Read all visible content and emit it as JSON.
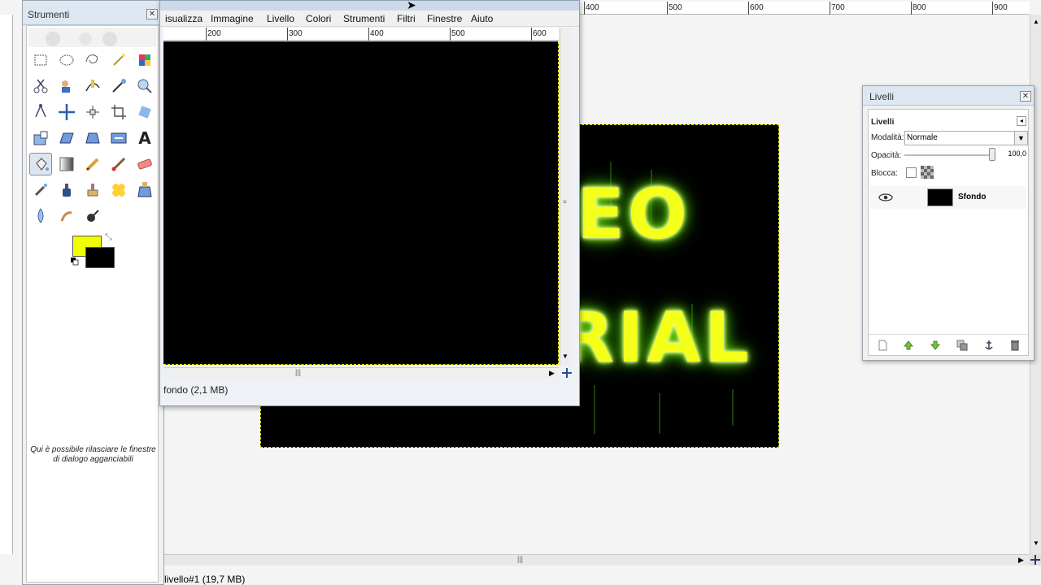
{
  "back_window": {
    "ruler_ticks": [
      "400",
      "500",
      "600",
      "700",
      "800",
      "900"
    ],
    "status_text": "livello#1 (19,7 MB)",
    "canvas_text_line1": "EO",
    "canvas_text_line2": "RIAL"
  },
  "front_window": {
    "menu": [
      "isualizza",
      "Immagine",
      "Livello",
      "Colori",
      "Strumenti",
      "Filtri",
      "Finestre",
      "Aiuto"
    ],
    "ruler_ticks": [
      "200",
      "300",
      "400",
      "500",
      "600"
    ],
    "status_text": "fondo (2,1 MB)"
  },
  "toolbox": {
    "title": "Strumenti",
    "dock_hint": "Qui è possibile rilasciare le finestre di dialogo agganciabili",
    "foreground_color": "#f0ff00",
    "background_color": "#000000",
    "tools": [
      "rect-select-icon",
      "ellipse-select-icon",
      "free-select-icon",
      "fuzzy-select-icon",
      "color-select-icon",
      "scissors-icon",
      "foreground-select-icon",
      "paths-icon",
      "color-picker-icon",
      "zoom-icon",
      "measure-icon",
      "move-icon",
      "align-icon",
      "crop-icon",
      "rotate-icon",
      "scale-icon",
      "shear-icon",
      "perspective-icon",
      "flip-icon",
      "text-icon",
      "bucket-fill-icon",
      "gradient-icon",
      "pencil-icon",
      "paintbrush-icon",
      "eraser-icon",
      "airbrush-icon",
      "ink-icon",
      "clone-icon",
      "heal-icon",
      "perspective-clone-icon",
      "blur-icon",
      "smudge-icon",
      "dodge-burn-icon"
    ]
  },
  "layers": {
    "window_title": "Livelli",
    "panel_title": "Livelli",
    "mode_label": "Modalità:",
    "mode_value": "Normale",
    "opacity_label": "Opacità:",
    "opacity_value": "100,0",
    "lock_label": "Blocca:",
    "layer_name": "Sfondo"
  }
}
